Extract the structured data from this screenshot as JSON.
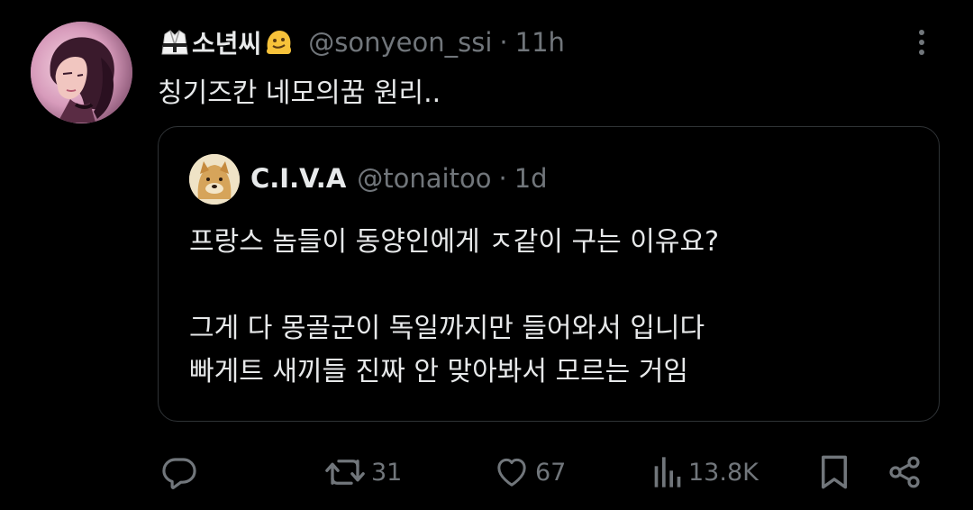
{
  "tweet": {
    "display_name": "소년씨",
    "handle": "@sonyeon_ssi",
    "separator": "·",
    "time": "11h",
    "text": "칭기즈칸 네모의꿈 원리..",
    "emoji_left": "martial-arts-uniform-emoji",
    "emoji_right": "melting-face-emoji"
  },
  "quoted": {
    "display_name": "C.I.V.A",
    "handle": "@tonaitoo",
    "separator": "·",
    "time": "1d",
    "lines": [
      "프랑스 놈들이 동양인에게 ㅈ같이 구는 이유요?",
      "",
      "그게 다 몽골군이 독일까지만 들어와서 입니다",
      "빠게트 새끼들 진짜 안 맞아봐서 모르는 거임"
    ]
  },
  "actions": {
    "reply_icon": "reply-icon",
    "retweet_icon": "retweet-icon",
    "retweet_count": "31",
    "like_icon": "heart-icon",
    "like_count": "67",
    "views_icon": "views-icon",
    "views_count": "13.8K",
    "bookmark_icon": "bookmark-icon",
    "share_icon": "share-icon"
  },
  "colors": {
    "background": "#000000",
    "primary_text": "#e7e9ea",
    "secondary_text": "#71767b",
    "border": "#2f3336"
  }
}
